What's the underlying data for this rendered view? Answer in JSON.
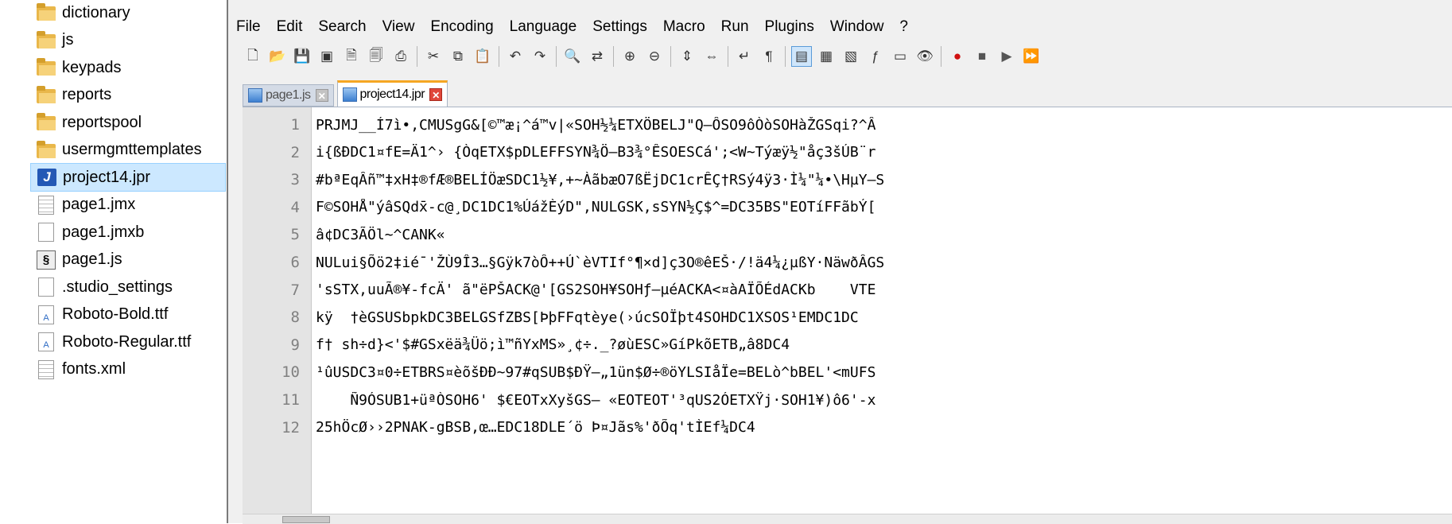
{
  "explorer": {
    "files": [
      {
        "label": "dictionary",
        "icon": "folder-icon"
      },
      {
        "label": "js",
        "icon": "folder-icon"
      },
      {
        "label": "keypads",
        "icon": "folder-icon"
      },
      {
        "label": "reports",
        "icon": "folder-icon"
      },
      {
        "label": "reportspool",
        "icon": "folder-icon"
      },
      {
        "label": "usermgmttemplates",
        "icon": "folder-icon"
      },
      {
        "label": "project14.jpr",
        "icon": "java-file-icon",
        "selected": true
      },
      {
        "label": "page1.jmx",
        "icon": "document-icon"
      },
      {
        "label": "page1.jmxb",
        "icon": "blank-file-icon"
      },
      {
        "label": "page1.js",
        "icon": "script-file-icon"
      },
      {
        "label": ".studio_settings",
        "icon": "blank-file-icon"
      },
      {
        "label": "Roboto-Bold.ttf",
        "icon": "font-file-icon"
      },
      {
        "label": "Roboto-Regular.ttf",
        "icon": "font-file-icon"
      },
      {
        "label": "fonts.xml",
        "icon": "document-icon"
      }
    ]
  },
  "menu": [
    "File",
    "Edit",
    "Search",
    "View",
    "Encoding",
    "Language",
    "Settings",
    "Macro",
    "Run",
    "Plugins",
    "Window",
    "?"
  ],
  "toolbar_icons": [
    "new-file-icon",
    "open-file-icon",
    "save-icon",
    "save-all-icon",
    "close-icon",
    "close-all-icon",
    "print-icon",
    "cut-icon",
    "copy-icon",
    "paste-icon",
    "undo-icon",
    "redo-icon",
    "find-icon",
    "replace-icon",
    "zoom-in-icon",
    "zoom-out-icon",
    "sync-vertical-icon",
    "sync-horizontal-icon",
    "word-wrap-icon",
    "show-all-chars-icon",
    "indent-guide-icon",
    "user-language-icon",
    "doc-map-icon",
    "function-list-icon",
    "folder-workspace-icon",
    "monitor-icon",
    "record-macro-icon",
    "stop-macro-icon",
    "play-macro-icon",
    "run-macro-multiple-icon"
  ],
  "tabs": [
    {
      "label": "page1.js",
      "active": false
    },
    {
      "label": "project14.jpr",
      "active": true
    }
  ],
  "editor": {
    "lines": [
      {
        "no": "1",
        "text": "PRJMJ__Í7ì•,CMUSgG&[©™æ¡^á™v|«SOH½¼ETXÖBELJ\"Q–ÔSO9ôÒòSOHàŽGSqi?^Â"
      },
      {
        "no": "2",
        "text": "i{ßÐDC1¤fE=Ä1^› {ÒqETX$pDLEFFSYN¾Ö—B3¾°ÊSOESCá';<W~Týæÿ½\"åç3šÚB¨r"
      },
      {
        "no": "3",
        "text": "#bªEqÂñ™‡xH‡®fÆ®BELÍÖæSDC1½¥,+~ÀãbæO7ßËjDC1crÊÇ†RSý4ÿ3·Ì¼\"¼•\\HµY—S"
      },
      {
        "no": "4",
        "text": "F©SOHÅ\"ýâSQdx̄-c@¸DC1DC1%ÚážÈýD\",NULGSK,sSYN½Ç$^=DC35BS\"EOTíFFãbÝ["
      },
      {
        "no": "5",
        "text": "â¢DC3ÃÖl~^CANK«"
      },
      {
        "no": "6",
        "text": "NULui§Õö2‡ié¯'ŽÙ9Î3…§Gÿk7òÔ++Ú`èVTIf°¶×d]ç3O®êEŠ·/!ä4¼¿µßY·NäwðÂGS"
      },
      {
        "no": "7",
        "text": "'sSTX,uuÃ®¥-fcÄ' ã\"ëPŠACK@'[GS2SOH¥SOHƒ—µéACKA<¤àAÏÕÉdACKb    VTE"
      },
      {
        "no": "8",
        "text": "kÿ  †èGSUSbpkDC3BELGSfZBS[ÞþFFqtèye(›úcSOÏþt4SOHDC1XSOS¹EMDC1DC"
      },
      {
        "no": "9",
        "text": "f† sh÷d}<'$#GSxëä¾Üö;ì™ñYxMS»¸¢÷._?øùESC»GíPkõETB„â8DC4"
      },
      {
        "no": "10",
        "text": "¹ûUSDC3¤0÷ETBRS¤èõšÐÐ~97#qSUB$ÐŸ–„1ün$Ø÷®öYLSIåÏe=BELò^bBEL'<mUFS"
      },
      {
        "no": "11",
        "text": "    Ñ9ÓSUB1+üªÒSOH6' $€EOTxXyšGS— «EOTEOT'³qUS2ÓETXŸj·SOH1¥)ô6'-x"
      },
      {
        "no": "12",
        "text": "25hÖcØ››2PNAK-gBSB,œ…EDC18DLE´ö Þ¤Jãs%'ðÕq'tÌEf¼DC4"
      }
    ]
  }
}
